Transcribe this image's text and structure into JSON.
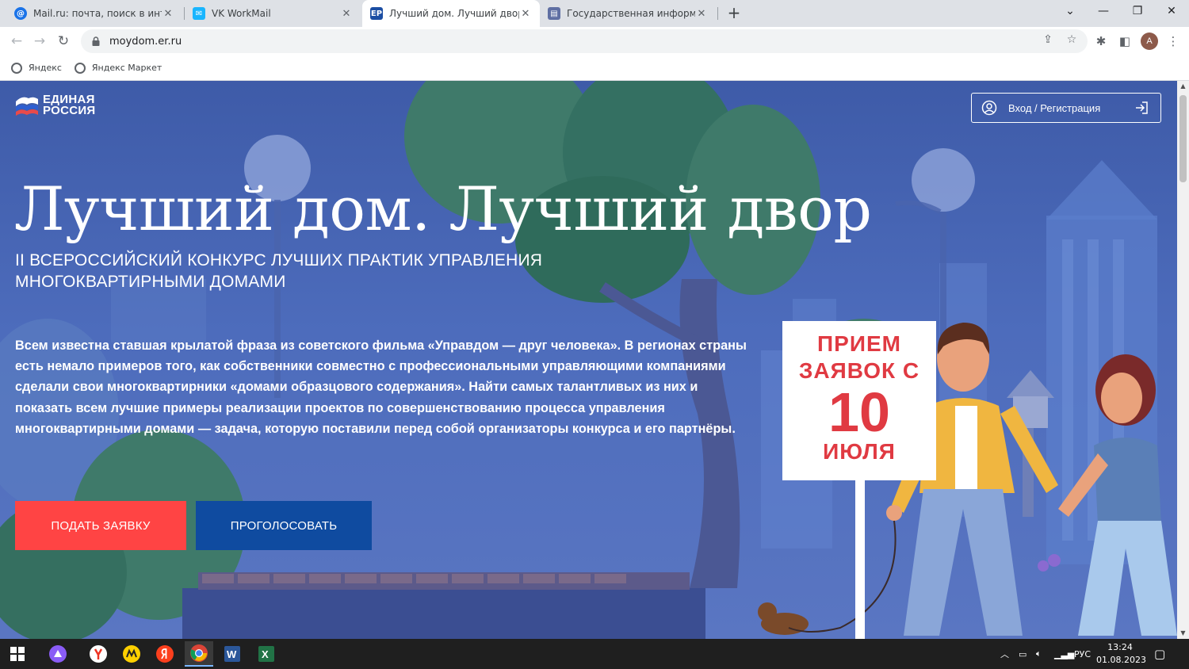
{
  "browser": {
    "tabs": [
      {
        "title": "Mail.ru: почта, поиск в интернете",
        "active": false
      },
      {
        "title": "VK WorkMail",
        "active": false
      },
      {
        "title": "Лучший дом. Лучший двор",
        "active": true
      },
      {
        "title": "Государственная информационная",
        "active": false
      }
    ],
    "new_tab": "+",
    "url": "moydom.er.ru",
    "profile_initial": "A",
    "bookmarks": [
      {
        "label": "Яндекс"
      },
      {
        "label": "Яндекс Маркет"
      }
    ]
  },
  "page": {
    "logo": {
      "line1": "ЕДИНАЯ",
      "line2": "РОССИЯ"
    },
    "login_label": "Вход / Регистрация",
    "title": "Лучший дом. Лучший двор",
    "subtitle": "II ВСЕРОССИЙСКИЙ КОНКУРС ЛУЧШИХ ПРАКТИК УПРАВЛЕНИЯ МНОГОКВАРТИРНЫМИ ДОМАМИ",
    "description": "Всем известна ставшая крылатой фраза из советского фильма «Управдом — друг человека». В регионах страны есть немало примеров того, как собственники совместно с профессиональными управляющими компаниями сделали свои многоквартирники «домами образцового содержания». Найти самых талантливых из них и показать всем лучшие примеры реализации проектов по совершенствованию процесса управления многоквартирными домами — задача, которую поставили перед собой организаторы конкурса и его партнёры.",
    "apply_button": "ПОДАТЬ ЗАЯВКУ",
    "vote_button": "ПРОГОЛОСОВАТЬ",
    "sign": {
      "line1": "ПРИЕМ",
      "line2": "ЗАЯВОК С",
      "day": "10",
      "month": "ИЮЛЯ"
    }
  },
  "taskbar": {
    "language": "РУС",
    "time": "13:24",
    "date": "01.08.2023"
  },
  "colors": {
    "apply_button": "#ff4444",
    "vote_button": "#0f4ba0",
    "sign_text": "#e03a42",
    "hero_background": "#4d6cbc"
  }
}
